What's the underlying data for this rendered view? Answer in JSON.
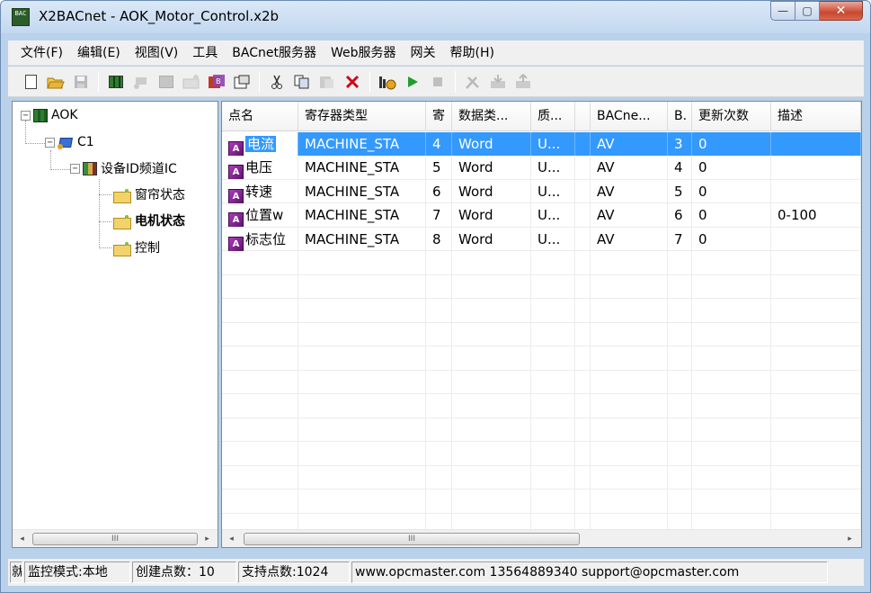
{
  "window": {
    "title": "X2BACnet - AOK_Motor_Control.x2b",
    "icon_text": "BAC",
    "min_glyph": "—",
    "max_glyph": "▢",
    "close_glyph": "✕"
  },
  "menu": [
    "文件(F)",
    "编辑(E)",
    "视图(V)",
    "工具",
    "BACnet服务器",
    "Web服务器",
    "网关",
    "帮助(H)"
  ],
  "toolbar_icons": [
    "new-icon",
    "open-icon",
    "save-icon",
    "server-icon",
    "channel-icon",
    "device-icon",
    "tag-icon",
    "bacnet-icon",
    "properties-icon",
    "cut-icon",
    "copy-icon",
    "paste-icon",
    "delete-icon",
    "monitor-icon",
    "run-icon",
    "stop-icon",
    "tools-icon",
    "load-icon",
    "upload-icon"
  ],
  "tree": {
    "root": "AOK",
    "channel": "C1",
    "device": "设备ID频道IC",
    "groups": [
      "窗帘状态",
      "电机状态",
      "控制"
    ]
  },
  "table": {
    "columns": [
      "点名",
      "寄存器类型",
      "寄",
      "数据类...",
      "质...",
      "",
      "BACne...",
      "B.",
      "更新次数",
      "描述"
    ],
    "rows": [
      {
        "name": "电流",
        "reg": "MACHINE_STA",
        "addr": "4",
        "dtype": "Word",
        "quality": "U...",
        "blank": "",
        "bacnet": "AV",
        "b": "3",
        "updates": "0",
        "desc": ""
      },
      {
        "name": "电压",
        "reg": "MACHINE_STA",
        "addr": "5",
        "dtype": "Word",
        "quality": "U...",
        "blank": "",
        "bacnet": "AV",
        "b": "4",
        "updates": "0",
        "desc": ""
      },
      {
        "name": "转速",
        "reg": "MACHINE_STA",
        "addr": "6",
        "dtype": "Word",
        "quality": "U...",
        "blank": "",
        "bacnet": "AV",
        "b": "5",
        "updates": "0",
        "desc": ""
      },
      {
        "name": "位置w",
        "reg": "MACHINE_STA",
        "addr": "7",
        "dtype": "Word",
        "quality": "U...",
        "blank": "",
        "bacnet": "AV",
        "b": "6",
        "updates": "0",
        "desc": "0-100"
      },
      {
        "name": "标志位",
        "reg": "MACHINE_STA",
        "addr": "8",
        "dtype": "Word",
        "quality": "U...",
        "blank": "",
        "bacnet": "AV",
        "b": "7",
        "updates": "0",
        "desc": ""
      }
    ],
    "point_icon_letter": "A"
  },
  "scroll": {
    "left_arrow": "◂",
    "right_arrow": "▸",
    "grip": "III"
  },
  "status": {
    "p0": "就",
    "mode": "监控模式:本地",
    "created": "创建点数：10",
    "supported": "支持点数:1024",
    "contact": "www.opcmaster.com 13564889340 support@opcmaster.com"
  }
}
